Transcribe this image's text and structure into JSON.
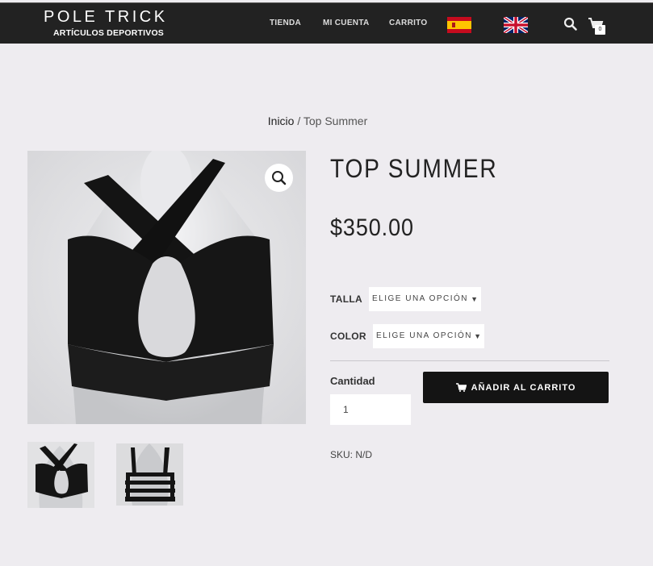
{
  "header": {
    "logo_title": "POLE TRICK",
    "logo_subtitle": "ARTÍCULOS DEPORTIVOS",
    "nav": [
      "TIENDA",
      "MI CUENTA",
      "CARRITO"
    ],
    "cart_count": "0",
    "icons": [
      "flag-spain-icon",
      "flag-uk-icon",
      "search-icon",
      "cart-icon"
    ]
  },
  "breadcrumb": {
    "home": "Inicio",
    "separator": " / ",
    "current": "Top Summer"
  },
  "product": {
    "title": "TOP SUMMER",
    "price": "$350.00",
    "variations": [
      {
        "label": "TALLA",
        "selected": "ELIGE UNA OPCIÓN"
      },
      {
        "label": "COLOR",
        "selected": "ELIGE UNA OPCIÓN"
      }
    ],
    "quantity_label": "Cantidad",
    "quantity_value": "1",
    "add_to_cart": "AÑADIR AL CARRITO",
    "sku": "SKU: N/D"
  },
  "colors": {
    "header_bg": "#222222",
    "page_bg": "#eeecf0",
    "button_bg": "#141414"
  }
}
